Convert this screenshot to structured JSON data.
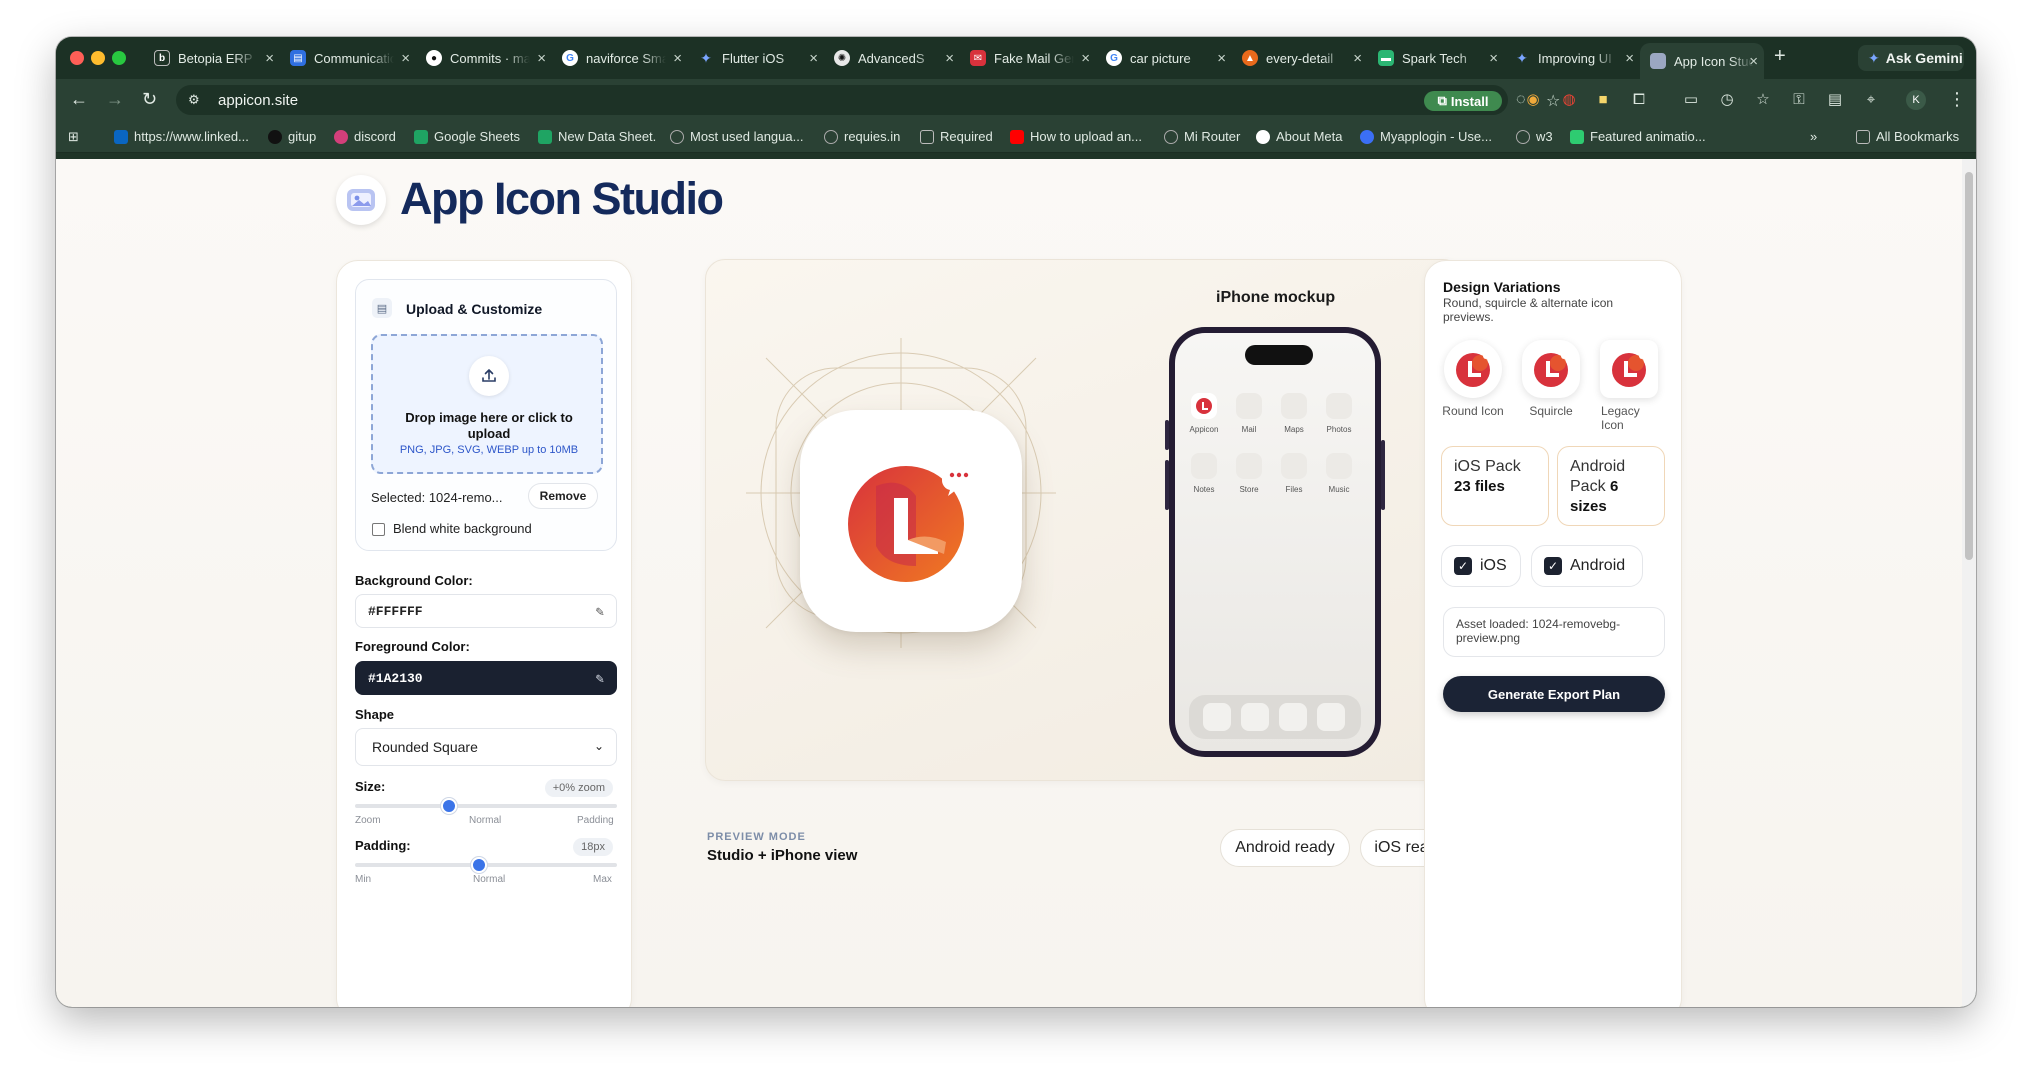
{
  "browser": {
    "tabs": [
      {
        "label": "Betopia ERP",
        "color": "#1f3427",
        "icon": "b-logo"
      },
      {
        "label": "Communication",
        "color": "#2f6fe0",
        "icon": "doc-icon"
      },
      {
        "label": "Commits · main",
        "color": "#111111",
        "icon": "github-icon"
      },
      {
        "label": "naviforce Smart",
        "color": "#ffffff",
        "icon": "google-icon"
      },
      {
        "label": "Flutter iOS",
        "color": "#4f7cf2",
        "icon": "gemini-icon"
      },
      {
        "label": "AdvancedS",
        "color": "#e8e8e8",
        "icon": "chatgpt-icon"
      },
      {
        "label": "Fake Mail Generator",
        "color": "#d8323c",
        "icon": "mail-icon"
      },
      {
        "label": "car picture",
        "color": "#ffffff",
        "icon": "google-icon"
      },
      {
        "label": "every-detail",
        "color": "#e86a1c",
        "icon": "brave-icon"
      },
      {
        "label": "Spark Tech",
        "color": "#2bb673",
        "icon": "spark-icon"
      },
      {
        "label": "Improving UI",
        "color": "#4f7cf2",
        "icon": "gemini-icon"
      },
      {
        "label": "App Icon Studio",
        "color": "#9ba7c2",
        "icon": "app-icon"
      }
    ],
    "ask_gemini": "Ask Gemini",
    "url": "appicon.site",
    "install_label": "Install",
    "profile_initial": "K",
    "bookmarks": [
      {
        "label": "https://www.linked...",
        "color": "#0a66c2"
      },
      {
        "label": "gitup",
        "color": "#111111"
      },
      {
        "label": "discord",
        "color": "#d33f7a"
      },
      {
        "label": "Google Sheets",
        "color": "#1fa463"
      },
      {
        "label": "New Data Sheet.",
        "color": "#1fa463"
      },
      {
        "label": "Most used langua...",
        "color": "#888888"
      },
      {
        "label": "requies.in",
        "color": "#888888"
      },
      {
        "label": "Required",
        "color": "#888888"
      },
      {
        "label": "How to upload an...",
        "color": "#ff0000"
      },
      {
        "label": "Mi Router",
        "color": "#888888"
      },
      {
        "label": "About Meta",
        "color": "#ffffff"
      },
      {
        "label": "Myapplogin - Use...",
        "color": "#3b6ff5"
      },
      {
        "label": "w3",
        "color": "#888888"
      },
      {
        "label": "Featured animatio...",
        "color": "#2ecc71"
      }
    ],
    "more_bookmarks": "»",
    "all_bookmarks": "All Bookmarks"
  },
  "app": {
    "title": "App Icon Studio",
    "brand_color": "#142a5c"
  },
  "upload": {
    "title": "Upload & Customize",
    "drop_main": "Drop image here or click to upload",
    "drop_sub": "PNG, JPG, SVG, WEBP up to 10MB",
    "selected": "Selected: 1024-remo...",
    "remove_label": "Remove",
    "blend_label": "Blend white background",
    "blend_checked": false
  },
  "controls": {
    "bg_label": "Background Color:",
    "bg_value": "#FFFFFF",
    "fg_label": "Foreground Color:",
    "fg_value": "#1A2130",
    "shape_label": "Shape",
    "shape_value": "Rounded Square",
    "size_label": "Size:",
    "size_value": "+0% zoom",
    "size_level": 0.35,
    "size_ticks": [
      "Zoom",
      "Normal",
      "Padding"
    ],
    "padding_label": "Padding:",
    "padding_value": "18px",
    "padding_level": 0.47,
    "padding_ticks": [
      "Min",
      "Normal",
      "Max"
    ]
  },
  "preview": {
    "mockup_title": "iPhone mockup",
    "apps": [
      "Appicon",
      "Mail",
      "Maps",
      "Photos",
      "Notes",
      "Store",
      "Files",
      "Music"
    ],
    "mode_label": "PREVIEW MODE",
    "mode_value": "Studio + iPhone view",
    "android_ready": "Android ready",
    "ios_ready": "iOS ready",
    "icon_colors": {
      "primary": "#d8323c",
      "secondary": "#ec6b24"
    }
  },
  "variations": {
    "title": "Design Variations",
    "subtitle": "Round, squircle & alternate icon previews.",
    "items": [
      "Round Icon",
      "Squircle",
      "Legacy Icon"
    ],
    "ios_pack_label": "iOS Pack",
    "ios_pack_value": "23 files",
    "android_pack_label": "Android Pack",
    "android_pack_value": "6 sizes",
    "platform_ios": "iOS",
    "platform_android": "Android",
    "asset_loaded": "Asset loaded: 1024-removebg-preview.png",
    "generate_label": "Generate Export Plan"
  }
}
